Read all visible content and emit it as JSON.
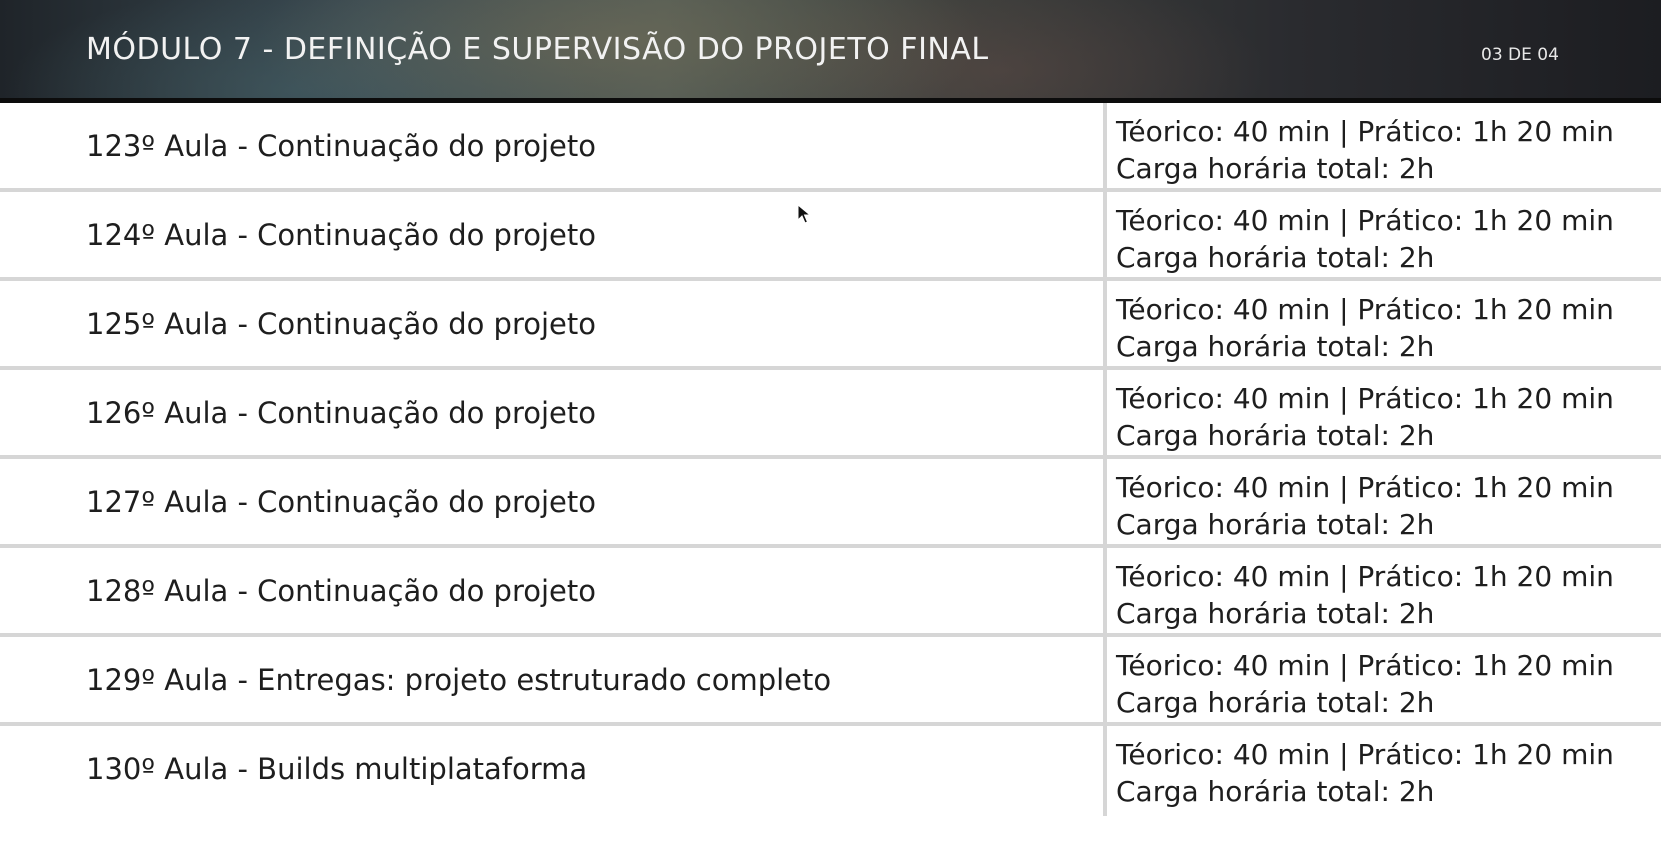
{
  "header": {
    "title": "MÓDULO 7 - DEFINIÇÃO E SUPERVISÃO DO PROJETO FINAL",
    "page": "03 DE 04"
  },
  "rows": [
    {
      "lesson": "123º Aula - Continuação do projeto",
      "hours_line1": "Téorico: 40 min | Prático: 1h 20 min",
      "hours_line2": "Carga horária total: 2h"
    },
    {
      "lesson": "124º Aula - Continuação do projeto",
      "hours_line1": "Téorico: 40 min | Prático: 1h 20 min",
      "hours_line2": "Carga horária total: 2h"
    },
    {
      "lesson": "125º Aula - Continuação do projeto",
      "hours_line1": "Téorico: 40 min | Prático: 1h 20 min",
      "hours_line2": "Carga horária total: 2h"
    },
    {
      "lesson": "126º Aula - Continuação do projeto",
      "hours_line1": "Téorico: 40 min | Prático: 1h 20 min",
      "hours_line2": "Carga horária total: 2h"
    },
    {
      "lesson": "127º Aula - Continuação do projeto",
      "hours_line1": "Téorico: 40 min | Prático: 1h 20 min",
      "hours_line2": "Carga horária total: 2h"
    },
    {
      "lesson": "128º Aula - Continuação do projeto",
      "hours_line1": "Téorico: 40 min | Prático: 1h 20 min",
      "hours_line2": "Carga horária total: 2h"
    },
    {
      "lesson": "129º Aula - Entregas: projeto estruturado completo",
      "hours_line1": "Téorico: 40 min | Prático: 1h 20 min",
      "hours_line2": "Carga horária total: 2h"
    },
    {
      "lesson": "130º Aula - Builds multiplataforma",
      "hours_line1": "Téorico: 40 min | Prático: 1h 20 min",
      "hours_line2": "Carga horária total: 2h"
    }
  ],
  "icons": {
    "cursor": "mouse-pointer-icon"
  }
}
